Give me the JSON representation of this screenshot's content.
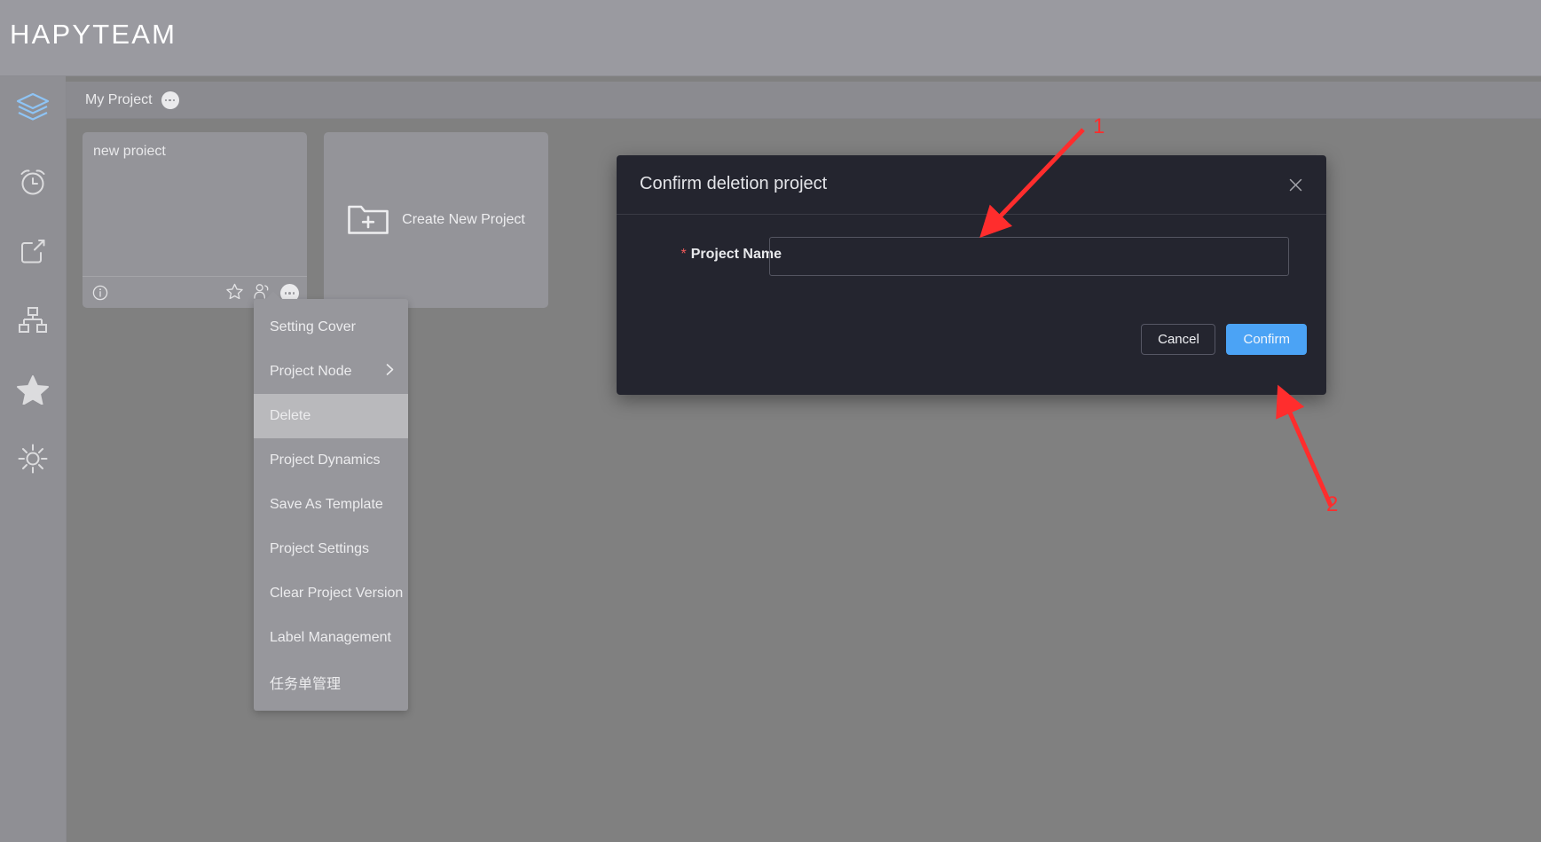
{
  "brand": {
    "title": "HAPYTEAM"
  },
  "sidebar": {
    "items": [
      {
        "icon": "layers-icon",
        "active": true
      },
      {
        "icon": "alarm-clock-icon",
        "active": false
      },
      {
        "icon": "share-export-icon",
        "active": false
      },
      {
        "icon": "org-chart-icon",
        "active": false
      },
      {
        "icon": "star-icon",
        "active": false
      },
      {
        "icon": "gear-icon",
        "active": false
      }
    ],
    "accent_color": "#8ec4f5"
  },
  "tabstrip": {
    "tab_label": "My Project",
    "more_icon": "ellipsis-icon"
  },
  "cards": {
    "project": {
      "title": "new proiect",
      "footer_icons": [
        "info-icon",
        "star-icon",
        "members-icon",
        "ellipsis-icon"
      ]
    },
    "create": {
      "label": "Create New Project",
      "icon": "new-folder-icon"
    }
  },
  "context_menu": {
    "items": [
      {
        "label": "Setting Cover",
        "highlighted": false,
        "submenu": false
      },
      {
        "label": "Project Node",
        "highlighted": false,
        "submenu": true
      },
      {
        "label": "Delete",
        "highlighted": true,
        "submenu": false
      },
      {
        "label": "Project Dynamics",
        "highlighted": false,
        "submenu": false
      },
      {
        "label": "Save As Template",
        "highlighted": false,
        "submenu": false
      },
      {
        "label": "Project Settings",
        "highlighted": false,
        "submenu": false
      },
      {
        "label": "Clear Project Version",
        "highlighted": false,
        "submenu": false
      },
      {
        "label": "Label Management",
        "highlighted": false,
        "submenu": false
      },
      {
        "label": "任务单管理",
        "highlighted": false,
        "submenu": false
      }
    ]
  },
  "modal": {
    "title": "Confirm deletion project",
    "close_icon": "close-icon",
    "field": {
      "required_mark": "*",
      "label": "Project Name",
      "value": "",
      "placeholder": ""
    },
    "buttons": {
      "cancel": "Cancel",
      "confirm": "Confirm",
      "confirm_color": "#4ba3f5"
    }
  },
  "annotations": {
    "color": "#ff2d2d",
    "markers": [
      {
        "number": "1",
        "target": "project-name-input"
      },
      {
        "number": "2",
        "target": "confirm-button"
      }
    ]
  }
}
